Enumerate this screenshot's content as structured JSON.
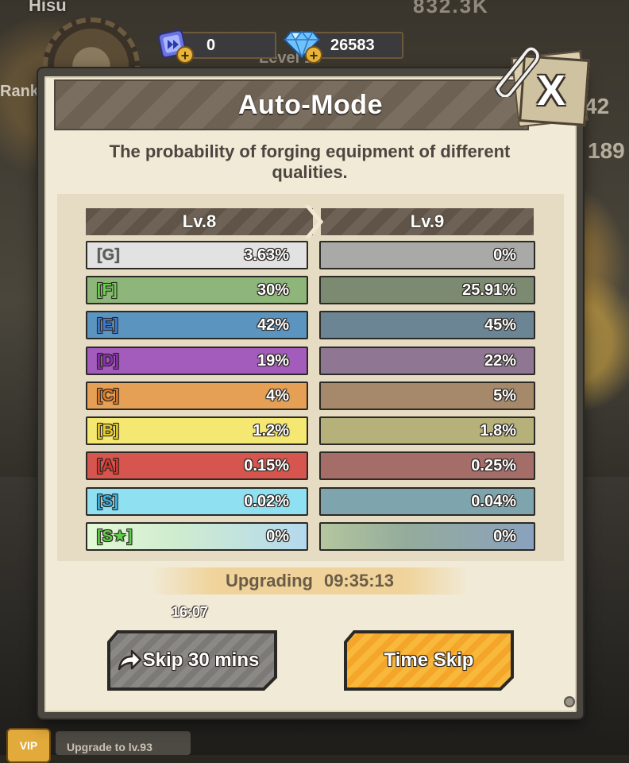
{
  "hud": {
    "player_name": "Hisu",
    "rank_label": "Ranki",
    "level_label": "Level 19",
    "top_right_partial": "832.3K",
    "right_num_1": "42",
    "right_num_2": "189",
    "tickets": "0",
    "gems": "26583",
    "bottom_upgrade": "Upgrade to lv.93",
    "bottom_badge": "VIP"
  },
  "modal": {
    "title": "Auto-Mode",
    "close_label": "X",
    "subtitle": "The probability of forging equipment of different qualities.",
    "col_current": "Lv.8",
    "col_next": "Lv.9",
    "rows": [
      {
        "grade": "[G]",
        "current": "3.63%",
        "next": "0%"
      },
      {
        "grade": "[F]",
        "current": "30%",
        "next": "25.91%"
      },
      {
        "grade": "[E]",
        "current": "42%",
        "next": "45%"
      },
      {
        "grade": "[D]",
        "current": "19%",
        "next": "22%"
      },
      {
        "grade": "[C]",
        "current": "4%",
        "next": "5%"
      },
      {
        "grade": "[B]",
        "current": "1.2%",
        "next": "1.8%"
      },
      {
        "grade": "[A]",
        "current": "0.15%",
        "next": "0.25%"
      },
      {
        "grade": "[S]",
        "current": "0.02%",
        "next": "0.04%"
      },
      {
        "grade": "[S★]",
        "current": "0%",
        "next": "0%"
      }
    ],
    "upgrading_label": "Upgrading",
    "upgrading_time": "09:35:13",
    "small_time": "16:07",
    "skip_button": "Skip 30 mins",
    "timeskip_button": "Time Skip"
  },
  "colors": {
    "G": "#e4e4e4",
    "F": "#8fb87a",
    "E": "#5b97c2",
    "D": "#a45bbd",
    "C": "#e7a253",
    "B": "#f5ea74",
    "A": "#d8574f",
    "S": "#8ee0f2",
    "grade_text_G": "#5a5a5a",
    "grade_text_F": "#4fae3d",
    "grade_text_E": "#3e67b6",
    "grade_text_D": "#7a2f95",
    "grade_text_C": "#c06a23",
    "grade_text_B": "#a88b18",
    "grade_text_A": "#b42323",
    "grade_text_S": "#2c8cbf",
    "grade_text_Sstar": "#47b13c"
  }
}
